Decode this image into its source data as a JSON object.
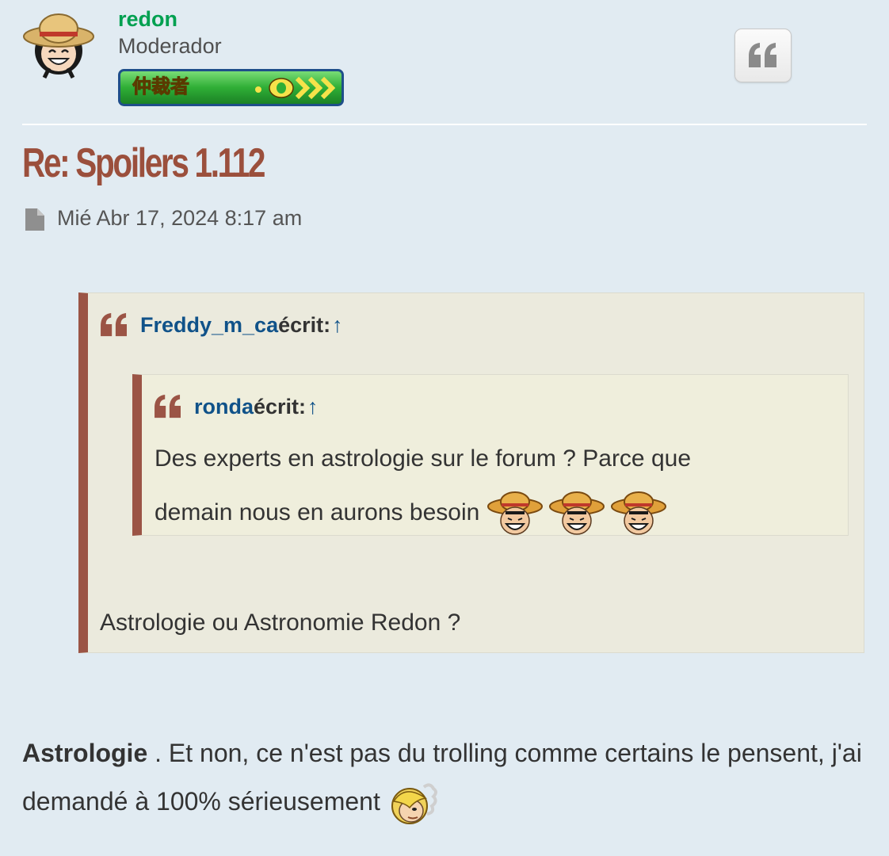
{
  "post": {
    "author": "redon",
    "rank": "Moderador",
    "rank_badge_text": "仲裁者",
    "title": "Re: Spoilers 1.112",
    "date": "Mié Abr 17, 2024 8:17 am",
    "quote_button_icon": "quote-icon",
    "colors": {
      "username": "#00a050",
      "title": "#9b4f3c",
      "quote_border": "#9b5445",
      "link": "#105289"
    }
  },
  "quote_outer": {
    "author": "Freddy_m_ca",
    "wrote": "écrit:",
    "arrow": "↑",
    "text": "Astrologie ou Astronomie Redon ?"
  },
  "quote_inner": {
    "author": "ronda",
    "wrote": "écrit:",
    "arrow": "↑",
    "text_line1": "Des experts en astrologie sur le forum ? Parce que",
    "text_line2": "demain nous en aurons besoin",
    "smileys": [
      "luffy-laugh-icon",
      "luffy-laugh-icon",
      "luffy-laugh-icon"
    ]
  },
  "body": {
    "bold": "Astrologie",
    "text": " . Et non, ce n'est pas du trolling comme certains le pensent, j'ai demandé à 100% sérieusement",
    "smiley": "sanji-smoke-icon"
  }
}
